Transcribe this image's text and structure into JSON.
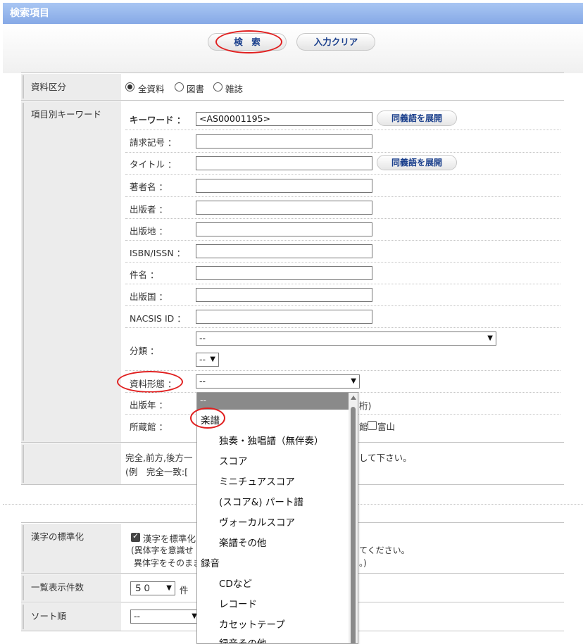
{
  "header": {
    "title": "検索項目"
  },
  "actions": {
    "search_label": "検　索",
    "clear_label": "入力クリア"
  },
  "doc_type": {
    "label": "資料区分",
    "options": [
      {
        "label": "全資料",
        "selected": true
      },
      {
        "label": "図書",
        "selected": false
      },
      {
        "label": "雑誌",
        "selected": false
      }
    ]
  },
  "keyword_section": {
    "label": "項目別キーワード",
    "expand_synonyms": "同義語を展開",
    "fields": {
      "keyword": {
        "label": "キーワード ：",
        "value": "<AS00001195>"
      },
      "call_number": {
        "label": "請求記号 ：",
        "value": ""
      },
      "title": {
        "label": "タイトル ：",
        "value": ""
      },
      "author": {
        "label": "著者名 ：",
        "value": ""
      },
      "publisher": {
        "label": "出版者 ：",
        "value": ""
      },
      "place": {
        "label": "出版地 ：",
        "value": ""
      },
      "isbn": {
        "label": "ISBN/ISSN ：",
        "value": ""
      },
      "subject": {
        "label": "件名 ：",
        "value": ""
      },
      "country": {
        "label": "出版国 ：",
        "value": ""
      },
      "nacsis": {
        "label": "NACSIS ID ：",
        "value": ""
      }
    },
    "classification": {
      "label": "分類 ：",
      "value": "--",
      "sub_value": "--"
    },
    "material_form": {
      "label": "資料形態 ：",
      "value": "--"
    },
    "pub_year": {
      "label": "出版年 ：",
      "visible_suffix": "桁)"
    },
    "library": {
      "label": "所蔵館 ：",
      "partial": "館",
      "toyama_label": "富山"
    }
  },
  "note": {
    "line1_a": "完全,前方,後方一",
    "line1_b": "して下さい。",
    "line2": "(例　完全一致:["
  },
  "kanji": {
    "label": "漢字の標準化",
    "check_label": "漢字を標準化",
    "line2_a": "(異体字を意識せ",
    "line2_b": "てください。",
    "line3_a": "異体字をそのまま",
    "line3_b": "。)"
  },
  "display_count": {
    "label": "一覧表示件数",
    "value": "５０",
    "suffix": "件"
  },
  "sort": {
    "label": "ソート順",
    "value": "--"
  },
  "dropdown": {
    "selected": "--",
    "groups": [
      {
        "label": "楽譜",
        "items": [
          "独奏・独唱譜（無伴奏）",
          "スコア",
          "ミニチュアスコア",
          "(スコア&) パート譜",
          "ヴォーカルスコア",
          "楽譜その他"
        ]
      },
      {
        "label": "録音",
        "items": [
          "CDなど",
          "レコード",
          "カセットテープ",
          "録音その他"
        ]
      }
    ]
  }
}
